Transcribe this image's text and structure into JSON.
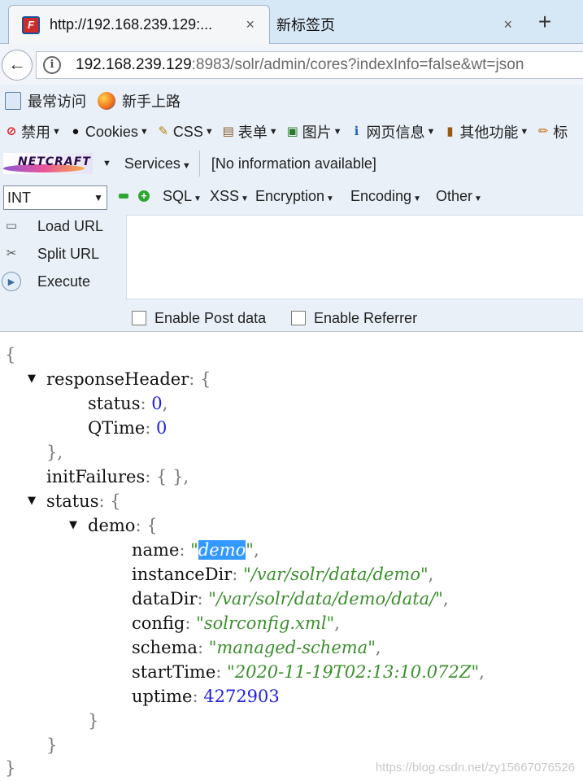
{
  "browser": {
    "tabs": [
      {
        "title": "http://192.168.239.129:...",
        "close": "×"
      },
      {
        "title": "新标签页",
        "close": "×"
      }
    ],
    "new_tab": "+",
    "back": "←",
    "url_host": "192.168.239.129",
    "url_rest": ":8983/solr/admin/cores?indexInfo=false&wt=json",
    "info_icon": "i"
  },
  "bookmarks": [
    {
      "label": "最常访问",
      "icon": "page-icon"
    },
    {
      "label": "新手上路",
      "icon": "firefox-icon"
    }
  ],
  "devbar": [
    {
      "label": "禁用",
      "icon": "no-entry-icon",
      "glyph": "⊘",
      "color": "#d22"
    },
    {
      "label": "Cookies",
      "icon": "user-icon",
      "glyph": "👤",
      "color": "#111"
    },
    {
      "label": "CSS",
      "icon": "wand-icon",
      "glyph": "✎",
      "color": "#b8860b"
    },
    {
      "label": "表单",
      "icon": "clipboard-icon",
      "glyph": "▤",
      "color": "#8a5a2b"
    },
    {
      "label": "图片",
      "icon": "image-icon",
      "glyph": "▣",
      "color": "#2a7a2a"
    },
    {
      "label": "网页信息",
      "icon": "info-icon",
      "glyph": "ℹ",
      "color": "#1f5fbf"
    },
    {
      "label": "其他功能",
      "icon": "book-icon",
      "glyph": "▮",
      "color": "#9a5a1a"
    },
    {
      "label": "标",
      "icon": "pencil-icon",
      "glyph": "✏",
      "color": "#c86a10"
    }
  ],
  "netcraft": {
    "logo": "NETCRAFT",
    "services": "Services",
    "info": "[No information available]"
  },
  "hackbar": {
    "select_value": "INT",
    "menus": [
      "SQL",
      "XSS",
      "Encryption",
      "Encoding",
      "Other"
    ],
    "load_url": "Load URL",
    "split_url": "Split URL",
    "execute": "Execute",
    "post_label": "Enable Post data",
    "referrer_label": "Enable Referrer"
  },
  "json_view": {
    "open_root": "{",
    "close_root": "}",
    "responseHeader_key": "responseHeader",
    "status_key": "status",
    "status_val": "0",
    "qtime_key": "QTime",
    "qtime_val": "0",
    "initFailures_key": "initFailures",
    "initFailures_val": "{ }",
    "status2_key": "status",
    "demo_key": "demo",
    "name_key": "name",
    "name_val": "demo",
    "instanceDir_key": "instanceDir",
    "instanceDir_val": "/var/solr/data/demo",
    "dataDir_key": "dataDir",
    "dataDir_val": "/var/solr/data/demo/data/",
    "config_key": "config",
    "config_val": "solrconfig.xml",
    "schema_key": "schema",
    "schema_val": "managed-schema",
    "startTime_key": "startTime",
    "startTime_val": "2020-11-19T02:13:10.072Z",
    "uptime_key": "uptime",
    "uptime_val": "4272903"
  },
  "watermark": "https://blog.csdn.net/zy15667076526"
}
